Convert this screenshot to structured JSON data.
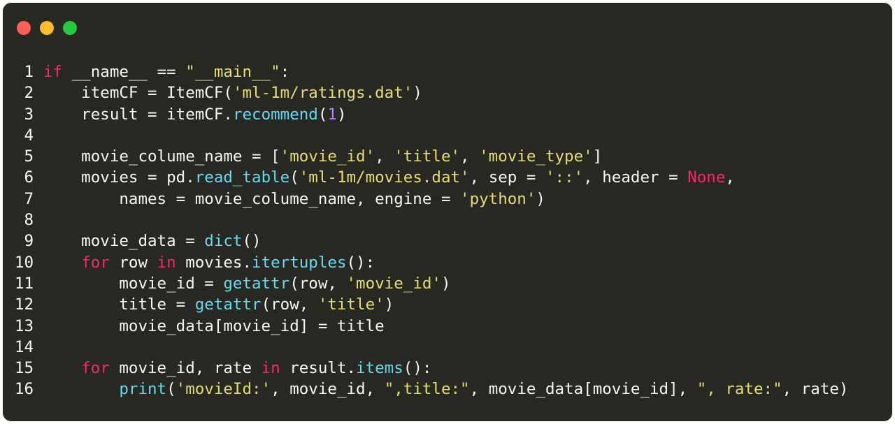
{
  "colors": {
    "background": "#272822",
    "close": "#ff5f56",
    "minimize": "#ffbd2e",
    "maximize": "#27c93f",
    "keyword": "#f92672",
    "string": "#e6db74",
    "function": "#66d9ef",
    "number": "#ae81ff",
    "text": "#f8f8f2"
  },
  "code": {
    "lines": [
      {
        "n": "1",
        "tokens": [
          {
            "t": "if",
            "c": "kw"
          },
          {
            "t": " __name__ == ",
            "c": "plain"
          },
          {
            "t": "\"__main__\"",
            "c": "str"
          },
          {
            "t": ":",
            "c": "plain"
          }
        ]
      },
      {
        "n": "2",
        "tokens": [
          {
            "t": "    itemCF = ItemCF(",
            "c": "plain"
          },
          {
            "t": "'ml-1m/ratings.dat'",
            "c": "str"
          },
          {
            "t": ")",
            "c": "plain"
          }
        ]
      },
      {
        "n": "3",
        "tokens": [
          {
            "t": "    result = itemCF.",
            "c": "plain"
          },
          {
            "t": "recommend",
            "c": "fn"
          },
          {
            "t": "(",
            "c": "plain"
          },
          {
            "t": "1",
            "c": "num"
          },
          {
            "t": ")",
            "c": "plain"
          }
        ]
      },
      {
        "n": "4",
        "tokens": []
      },
      {
        "n": "5",
        "tokens": [
          {
            "t": "    movie_colume_name = [",
            "c": "plain"
          },
          {
            "t": "'movie_id'",
            "c": "str"
          },
          {
            "t": ", ",
            "c": "plain"
          },
          {
            "t": "'title'",
            "c": "str"
          },
          {
            "t": ", ",
            "c": "plain"
          },
          {
            "t": "'movie_type'",
            "c": "str"
          },
          {
            "t": "]",
            "c": "plain"
          }
        ]
      },
      {
        "n": "6",
        "tokens": [
          {
            "t": "    movies = pd.",
            "c": "plain"
          },
          {
            "t": "read_table",
            "c": "fn"
          },
          {
            "t": "(",
            "c": "plain"
          },
          {
            "t": "'ml-1m/movies.dat'",
            "c": "str"
          },
          {
            "t": ", sep = ",
            "c": "plain"
          },
          {
            "t": "'::'",
            "c": "str"
          },
          {
            "t": ", header = ",
            "c": "plain"
          },
          {
            "t": "None",
            "c": "kw"
          },
          {
            "t": ",",
            "c": "plain"
          }
        ]
      },
      {
        "n": "7",
        "tokens": [
          {
            "t": "        names = movie_colume_name, engine = ",
            "c": "plain"
          },
          {
            "t": "'python'",
            "c": "str"
          },
          {
            "t": ")",
            "c": "plain"
          }
        ]
      },
      {
        "n": "8",
        "tokens": []
      },
      {
        "n": "9",
        "tokens": [
          {
            "t": "    movie_data = ",
            "c": "plain"
          },
          {
            "t": "dict",
            "c": "fn"
          },
          {
            "t": "()",
            "c": "plain"
          }
        ]
      },
      {
        "n": "10",
        "tokens": [
          {
            "t": "    ",
            "c": "plain"
          },
          {
            "t": "for",
            "c": "kw"
          },
          {
            "t": " row ",
            "c": "plain"
          },
          {
            "t": "in",
            "c": "kw"
          },
          {
            "t": " movies.",
            "c": "plain"
          },
          {
            "t": "itertuples",
            "c": "fn"
          },
          {
            "t": "():",
            "c": "plain"
          }
        ]
      },
      {
        "n": "11",
        "tokens": [
          {
            "t": "        movie_id = ",
            "c": "plain"
          },
          {
            "t": "getattr",
            "c": "fn"
          },
          {
            "t": "(row, ",
            "c": "plain"
          },
          {
            "t": "'movie_id'",
            "c": "str"
          },
          {
            "t": ")",
            "c": "plain"
          }
        ]
      },
      {
        "n": "12",
        "tokens": [
          {
            "t": "        title = ",
            "c": "plain"
          },
          {
            "t": "getattr",
            "c": "fn"
          },
          {
            "t": "(row, ",
            "c": "plain"
          },
          {
            "t": "'title'",
            "c": "str"
          },
          {
            "t": ")",
            "c": "plain"
          }
        ]
      },
      {
        "n": "13",
        "tokens": [
          {
            "t": "        movie_data[movie_id] = title",
            "c": "plain"
          }
        ]
      },
      {
        "n": "14",
        "tokens": []
      },
      {
        "n": "15",
        "tokens": [
          {
            "t": "    ",
            "c": "plain"
          },
          {
            "t": "for",
            "c": "kw"
          },
          {
            "t": " movie_id, rate ",
            "c": "plain"
          },
          {
            "t": "in",
            "c": "kw"
          },
          {
            "t": " result.",
            "c": "plain"
          },
          {
            "t": "items",
            "c": "fn"
          },
          {
            "t": "():",
            "c": "plain"
          }
        ]
      },
      {
        "n": "16",
        "tokens": [
          {
            "t": "        ",
            "c": "plain"
          },
          {
            "t": "print",
            "c": "fn"
          },
          {
            "t": "(",
            "c": "plain"
          },
          {
            "t": "'movieId:'",
            "c": "str"
          },
          {
            "t": ", movie_id, ",
            "c": "plain"
          },
          {
            "t": "\",title:\"",
            "c": "str"
          },
          {
            "t": ", movie_data[movie_id], ",
            "c": "plain"
          },
          {
            "t": "\", rate:\"",
            "c": "str"
          },
          {
            "t": ", rate)",
            "c": "plain"
          }
        ]
      }
    ]
  }
}
